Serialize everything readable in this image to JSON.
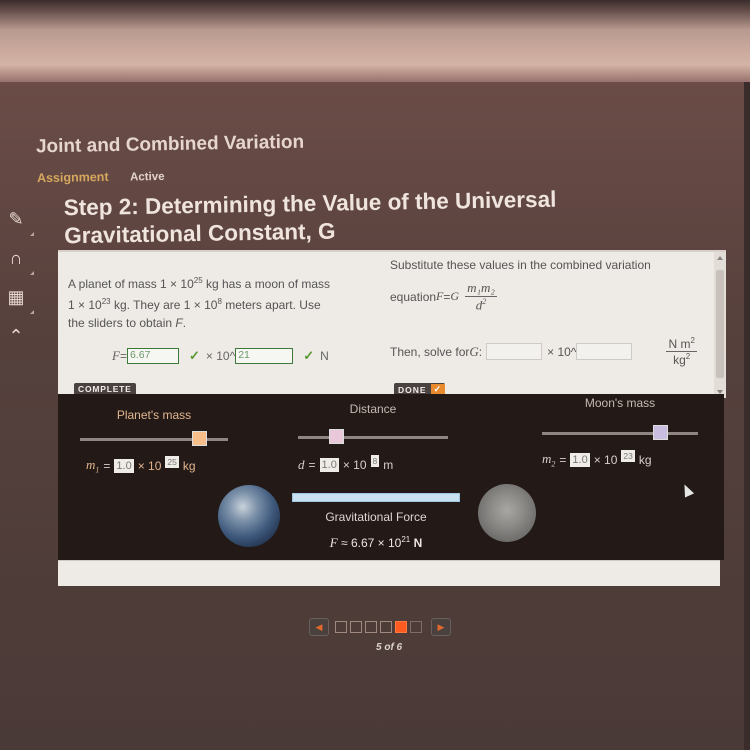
{
  "header": {
    "course_title": "Joint and Combined Variation",
    "assignment_label": "Assignment",
    "status_label": "Active",
    "step_title_line1": "Step 2: Determining the Value of the Universal",
    "step_title_line2": "Gravitational Constant, G"
  },
  "rail": {
    "items": [
      {
        "icon": "pencil-icon",
        "glyph": "✎"
      },
      {
        "icon": "headphones-icon",
        "glyph": "∩"
      },
      {
        "icon": "calculator-icon",
        "glyph": "▦"
      },
      {
        "icon": "collapse-up-icon",
        "glyph": "⌃"
      }
    ]
  },
  "problem": {
    "text_line1_a": "A planet of mass 1 × 10",
    "text_line1_exp": "25",
    "text_line1_b": " kg has a moon of mass",
    "text_line2_a": "1 × 10",
    "text_line2_exp": "23",
    "text_line2_b": " kg. They are 1 × 10",
    "text_line2_exp2": "8",
    "text_line2_c": " meters apart. Use",
    "text_line3": "the sliders to obtain ",
    "text_line3_var": "F",
    "text_line3_end": ".",
    "f_label": "F",
    "equals": " = ",
    "f_mantissa_value": "6.67",
    "times_ten": "× 10^",
    "f_exponent_value": "21",
    "unit": "N",
    "check_glyph": "✓",
    "complete_label": "COMPLETE"
  },
  "substitute": {
    "text": "Substitute these values in the combined variation",
    "eq_prefix": "equation ",
    "eq_F": "F",
    "eq_eq": " = ",
    "eq_G": "G",
    "frac_num": "m₁m₂",
    "frac_den_base": "d",
    "frac_den_exp": "2",
    "solve_label": "Then, solve for ",
    "solve_var": "G",
    "solve_colon": ":",
    "g_mantissa_value": "",
    "times_ten": "× 10^",
    "g_exponent_value": "",
    "unit_num": "N m",
    "unit_num_exp": "2",
    "unit_den": "kg",
    "unit_den_exp": "2",
    "done_label": "DONE",
    "done_check": "✓"
  },
  "simulation": {
    "planet_slider": {
      "label": "Planet's mass",
      "position_fraction": 0.81,
      "var": "m",
      "var_sub": "1",
      "mantissa": "1.0",
      "times": "× 10",
      "exponent": "25",
      "unit": "kg"
    },
    "distance_slider": {
      "label": "Distance",
      "position_fraction": 0.26,
      "var": "d",
      "mantissa": "1.0",
      "times": "× 10",
      "exponent": "8",
      "unit": "m"
    },
    "moon_slider": {
      "label": "Moon's mass",
      "position_fraction": 0.76,
      "var": "m",
      "var_sub": "2",
      "mantissa": "1.0",
      "times": "× 10",
      "exponent": "23",
      "unit": "kg"
    },
    "force_label": "Gravitational Force",
    "force_var": "F",
    "force_approx": " ≈ 6.67 × 10",
    "force_exp": "21",
    "force_unit": " N"
  },
  "pager": {
    "prev_glyph": "◀",
    "next_glyph": "▶",
    "total_pages": 6,
    "current_page": 5,
    "count_text": "5 of 6"
  },
  "colors": {
    "accent_orange": "#e88a2e",
    "correct_green": "#5a9a32",
    "assignment_gold": "#d7a85e",
    "active_page": "#ff5a1f"
  }
}
